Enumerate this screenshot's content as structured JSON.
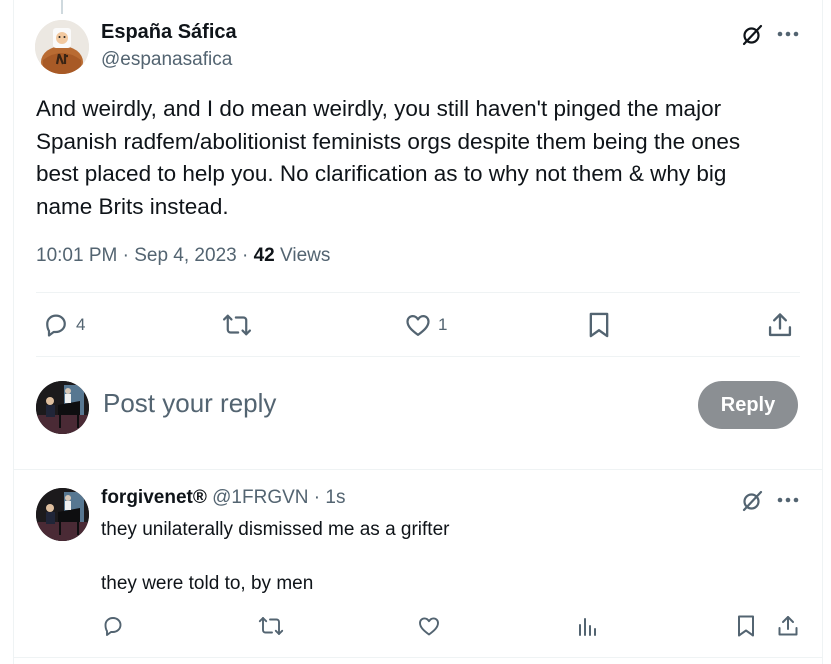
{
  "colors": {
    "text_primary": "#0f1419",
    "text_secondary": "#536471",
    "divider": "#eff3f4",
    "reply_button_bg": "#8b8f93",
    "reply_button_text": "#ffffff"
  },
  "tweet": {
    "author_name": "España Sáfica",
    "author_handle": "@espanasafica",
    "text_lines": [
      "And weirdly, and I do mean weirdly, you still haven't pinged the major",
      "Spanish radfem/abolitionist feminists orgs despite them being the ones",
      "best placed to help you.  No clarification as to why not them & why big",
      "name Brits instead."
    ],
    "time": "10:01 PM",
    "date": "Sep 4, 2023",
    "views_count": "42",
    "views_label": "Views",
    "sep": "·",
    "reply_count": "4",
    "like_count": "1",
    "icons": {
      "grok": "grok-icon",
      "more": "more-icon",
      "reply": "reply-icon",
      "retweet": "retweet-icon",
      "like": "like-icon",
      "bookmark": "bookmark-icon",
      "share": "share-icon"
    }
  },
  "composer": {
    "placeholder": "Post your reply",
    "reply_label": "Reply"
  },
  "reply": {
    "author_name": "forgivenet®",
    "author_handle": "@1FRGVN",
    "time_ago": "1s",
    "sep": "·",
    "text_lines": [
      "they unilaterally dismissed me as a grifter",
      "",
      "they were told to, by men"
    ],
    "icons": {
      "reply": "reply-icon",
      "retweet": "retweet-icon",
      "like": "like-icon",
      "views": "views-icon",
      "bookmark": "bookmark-icon",
      "share": "share-icon"
    }
  }
}
